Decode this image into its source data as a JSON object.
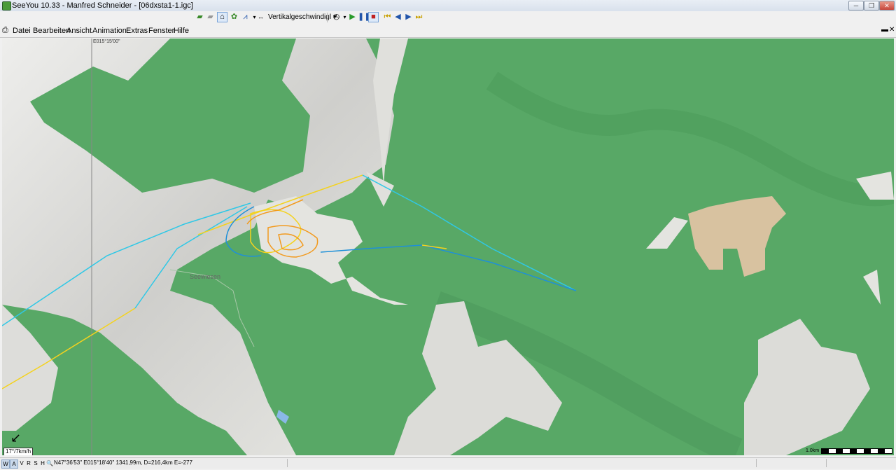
{
  "window": {
    "title": "SeeYou 10.33 - Manfred Schneider - [06dxsta1-1.igc]",
    "controls": {
      "minimize": "─",
      "restore": "❐",
      "close": "✕"
    }
  },
  "toolbar": {
    "combo_value": "Vertikalgeschwindigl",
    "combo_arrow": "▾",
    "icons": [
      "open-icon",
      "save-icon",
      "select-icon",
      "task-icon",
      "graph-icon",
      "play-mode-icon",
      "clock-icon",
      "play-icon",
      "pause-icon",
      "stop-icon",
      "to-start-icon",
      "prev-icon",
      "next-icon",
      "to-end-icon"
    ]
  },
  "menubar": {
    "items": [
      "Datei",
      "Bearbeiten",
      "Ansicht",
      "Animation",
      "Extras",
      "Fenster",
      "Hilfe"
    ],
    "mdi": {
      "minimize": "▬",
      "close": "✕"
    }
  },
  "map": {
    "grid_label": "E015°15'00\"",
    "place_label": "Seewiesen",
    "wind": "17°/7km/h",
    "scale_label": "1.0km",
    "colors": {
      "forest": "#58a866",
      "open": "#e6e6e2",
      "field": "#d8c2a0",
      "track_blue": "#1e90d8",
      "track_cyan": "#2fc8e6",
      "track_yellow": "#f4d21e",
      "track_orange": "#f29a1e"
    }
  },
  "statusbar": {
    "tabs": [
      "W",
      "A",
      "V",
      "R",
      "S",
      "H"
    ],
    "coords": "N47°36'53\" E015°18'40\" 1341,99m, D=216,4km E=-277"
  }
}
